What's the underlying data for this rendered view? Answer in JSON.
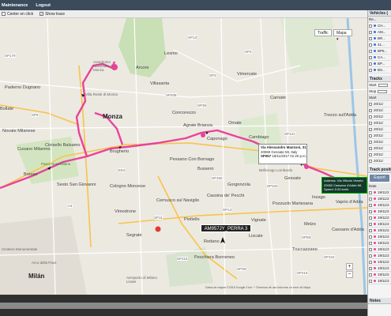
{
  "topbar": {
    "maintenance": "Maintenance",
    "logout": "Logout"
  },
  "options": {
    "center_on_click": "Center on click",
    "show_trace": "Show trace"
  },
  "map": {
    "type_buttons": [
      "Traffic",
      "Mapa"
    ],
    "zoom_in": "+",
    "zoom_out": "−",
    "towns": [
      "Arcore",
      "Villasanta",
      "Lesmo",
      "Vimercate",
      "Agrate Brianza",
      "Omate",
      "Carnate",
      "Monza",
      "Brugherio",
      "Cologno Monzese",
      "Sesto San Giovanni",
      "Cinisello Balsamo",
      "Cusano Milanino",
      "Bresso",
      "Milán",
      "Segrate",
      "Pioltello",
      "Vignate",
      "Melzo",
      "Cassina de' Pecchi",
      "Gorgonzola",
      "Gessate",
      "Trezzo sull'Adda",
      "Truccazzano",
      "Paderno Dugnano",
      "Novate Milanese",
      "Bollate",
      "Concorezzo",
      "Caponago",
      "Cambiago",
      "Pessano Con Bornago",
      "Bussero",
      "Cernusco sul Naviglio",
      "Vaprio d'Adda",
      "Peschiera Borromeo",
      "Liscate",
      "Vimodrone",
      "Rodano",
      "Pozzuolo Martesana",
      "Inzago",
      "Cassano d'Adda",
      "Bellinzago Lombardo"
    ],
    "places": [
      "Autodromo Nazionale di Monza",
      "Villa Reale di Monza",
      "Parco Nord Milano",
      "Aeroporto di Milano Linate",
      "Arco della Pace",
      "Cimitero Monumentale"
    ],
    "roads": [
      "SP13",
      "SP2",
      "SP3",
      "SP35",
      "SP208",
      "SP121",
      "SP14",
      "SP58",
      "SP103",
      "SP11",
      "SP160",
      "SP415",
      "SP216",
      "SP5",
      "SP179",
      "E64",
      "A4",
      "SP39",
      "SP104"
    ],
    "popup": {
      "address": "Via Alessandro Manzoni, 31,",
      "city": "20060 Gessate MI, Italy",
      "vehicle": "SP057",
      "datetime": "18/11/2017 01:20 p.m."
    },
    "popup2": {
      "address": "Address: Via Vittorio Veneto",
      "city": "20062 Cassano d'Adda MI,",
      "speed": "Speed: 0.00 km/h"
    },
    "plate": "AM957JY_PERRA 3",
    "attribution": "Datos de mapas ©2018 Google   2 km ─   Términos de uso   Informar un error de Maps"
  },
  "colors": {
    "track": "#e8439a",
    "topbar": "#3b4b5c",
    "button": "#6c87a8"
  },
  "sidebar": {
    "vehicles_title": "Vehicles (",
    "vehicles_header": "Re...",
    "vehicles": [
      {
        "name": "CH...",
        "color": "#3a6fd6"
      },
      {
        "name": "AM...",
        "color": "#3a6fd6"
      },
      {
        "name": "BR...",
        "color": "#3a6fd6"
      },
      {
        "name": "41...",
        "color": "#3a6fd6"
      },
      {
        "name": "BP5...",
        "color": "#3a6fd6"
      },
      {
        "name": "CA...",
        "color": "#3a6fd6"
      },
      {
        "name": "BP...",
        "color": "#3a6fd6"
      },
      {
        "name": "BS...",
        "color": "#3a6fd6"
      }
    ],
    "tracks_title": "Tracks",
    "start_label": "Start",
    "stop_label": "Stop",
    "list_header": "Start",
    "track_list": [
      "20/11/",
      "20/11/",
      "20/11/",
      "20/11/",
      "20/11/",
      "20/11/",
      "20/11/",
      "20/11/",
      "20/11/",
      "20/11/"
    ],
    "positions_title": "Track positions",
    "export_label": "Export",
    "positions_header": "Date",
    "positions": [
      "19/11/2",
      "19/11/2",
      "19/11/2",
      "19/11/2",
      "19/11/2",
      "19/11/2",
      "19/11/2",
      "19/11/2",
      "19/11/2",
      "19/11/2",
      "19/11/2",
      "19/11/2",
      "19/11/2",
      "19/11/2",
      "19/11/2"
    ],
    "notes_title": "Notes"
  }
}
